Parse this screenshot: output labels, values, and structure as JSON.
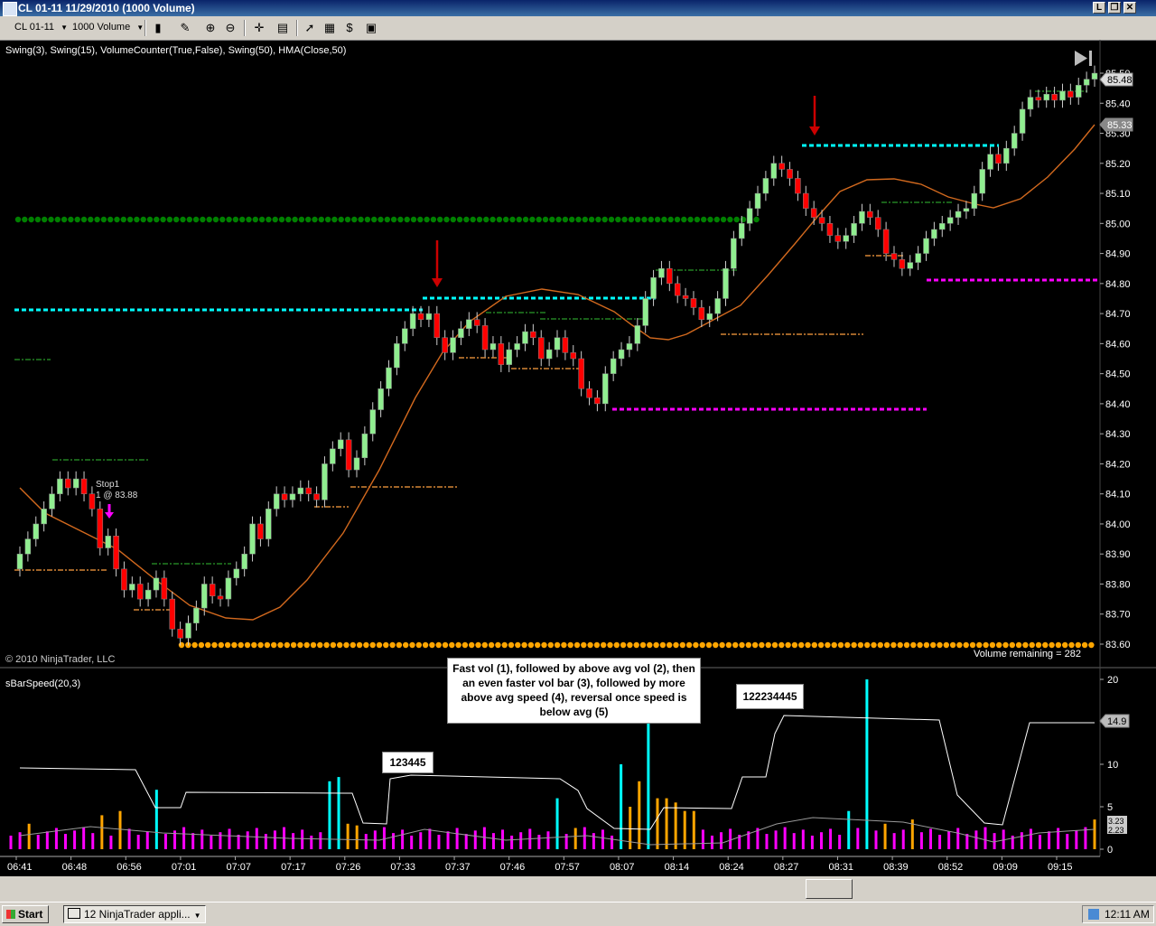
{
  "window": {
    "title": "CL 01-11  11/29/2010 (1000 Volume)",
    "controls": [
      "L",
      "❐",
      "✕"
    ]
  },
  "toolbar": {
    "instrument": "CL 01-11",
    "interval": "1000 Volume"
  },
  "price_panel": {
    "indicators_label": "Swing(3), Swing(15), VolumeCounter(True,False), Swing(50), HMA(Close,50)",
    "copyright": "© 2010 NinjaTrader, LLC",
    "volume_remaining": "Volume remaining = 282",
    "axis_ticks": [
      "85.50",
      "85.40",
      "85.30",
      "85.20",
      "85.10",
      "85.00",
      "84.90",
      "84.80",
      "84.70",
      "84.60",
      "84.50",
      "84.40",
      "84.30",
      "84.20",
      "84.10",
      "84.00",
      "83.90",
      "83.80",
      "83.70",
      "83.60"
    ],
    "last_price_tag": "85.48",
    "hma_tag": "85.33",
    "stop_label_line1": "Stop1",
    "stop_label_line2": "1 @ 83.88"
  },
  "speed_panel": {
    "label": "sBarSpeed(20,3)",
    "axis_ticks": [
      "20",
      "15",
      "10",
      "5",
      "0"
    ],
    "value_tag": "14.9",
    "small_tags": [
      "3.23",
      "2.23"
    ],
    "callout_main": "Fast vol (1), followed by above avg vol (2), then an even faster vol bar (3), followed by more above avg speed (4), reversal once speed is below avg (5)",
    "callout_1": "123445",
    "callout_2": "122234445"
  },
  "time_axis": [
    "06:41",
    "06:48",
    "06:56",
    "07:01",
    "07:07",
    "07:17",
    "07:26",
    "07:33",
    "07:37",
    "07:46",
    "07:57",
    "08:07",
    "08:14",
    "08:24",
    "08:27",
    "08:31",
    "08:39",
    "08:52",
    "09:09",
    "09:15"
  ],
  "taskbar": {
    "start": "Start",
    "task": "12 NinjaTrader appli...",
    "clock": "12:11 AM"
  },
  "colors": {
    "up_candle": "#90ee90",
    "down_candle": "#ff0000",
    "hma": "#d2691e",
    "cyan_line": "#00ffff",
    "magenta_line": "#ff00ff",
    "green_dots": "#008000",
    "orange_dots": "#ffa500",
    "arrow": "#cc0000"
  }
}
